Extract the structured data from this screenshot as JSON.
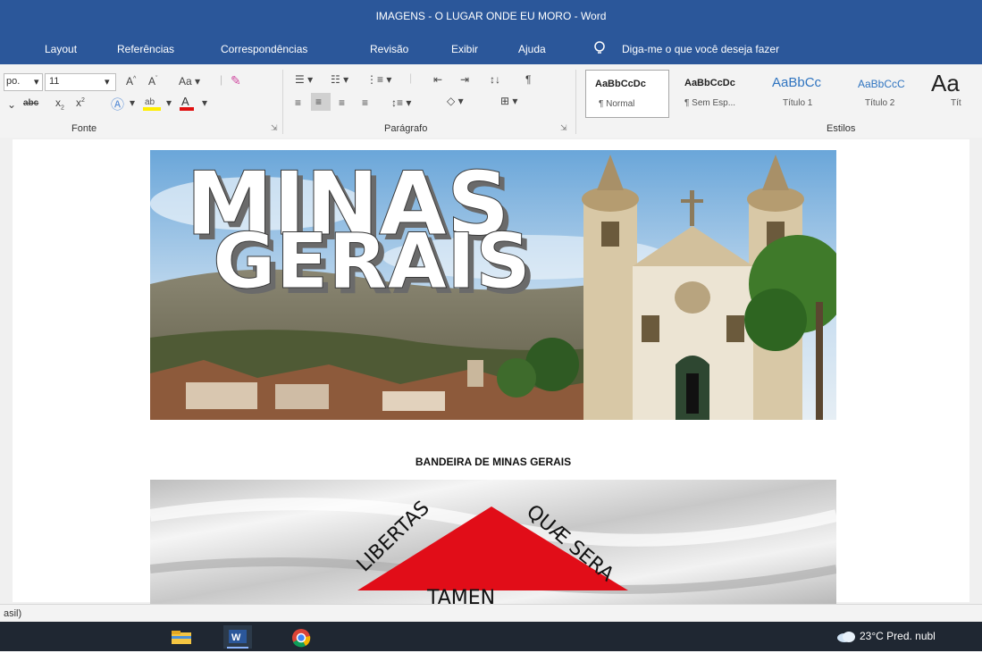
{
  "window": {
    "title": "IMAGENS - O LUGAR ONDE EU MORO  -  Word"
  },
  "menu": {
    "layout": "Layout",
    "referencias": "Referências",
    "correspondencias": "Correspondências",
    "revisao": "Revisão",
    "exibir": "Exibir",
    "ajuda": "Ajuda",
    "tell_me": "Diga-me o que você deseja fazer"
  },
  "font_group": {
    "font_name_partial": "po.",
    "font_size": "11",
    "label": "Fonte"
  },
  "paragraph_group": {
    "label": "Parágrafo"
  },
  "styles_group": {
    "label": "Estilos",
    "items": [
      {
        "sample": "AaBbCcDc",
        "name": "¶ Normal"
      },
      {
        "sample": "AaBbCcDc",
        "name": "¶ Sem Esp..."
      },
      {
        "sample": "AaBbCc",
        "name": "Título 1"
      },
      {
        "sample": "AaBbCcC",
        "name": "Título 2"
      },
      {
        "sample": "Aa",
        "name": "Tít"
      }
    ]
  },
  "document": {
    "banner_line1": "MINAS",
    "banner_line2": "GERAIS",
    "caption": "BANDEIRA DE MINAS GERAIS",
    "flag_left": "LIBERTAS",
    "flag_right": "QUÆ SERA",
    "flag_bottom": "TAMEN"
  },
  "status": {
    "language_partial": "asil)"
  },
  "taskbar": {
    "weather": "23°C  Pred. nubl"
  },
  "colors": {
    "word_blue": "#2b579a",
    "ribbon_bg": "#f3f3f3",
    "flag_red": "#e10d18",
    "taskbar_bg": "#1f2732"
  }
}
